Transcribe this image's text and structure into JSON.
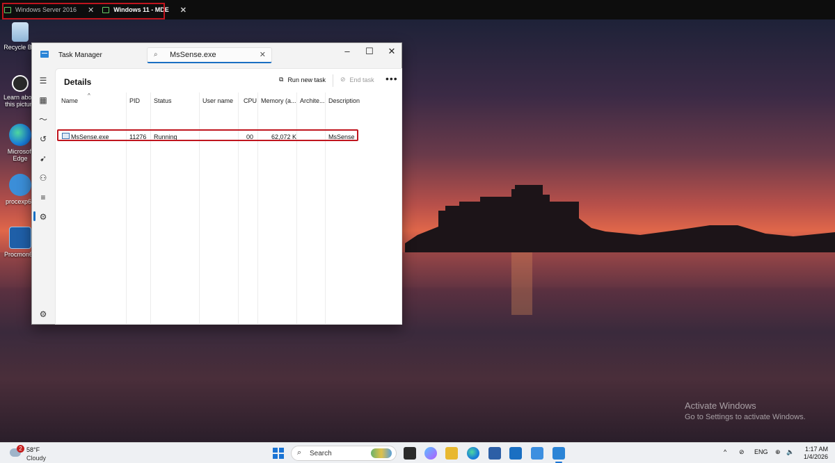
{
  "remote_tabs": [
    {
      "label": "Windows Server 2016",
      "close": "✕"
    },
    {
      "label": "Windows 11 - MDE",
      "close": "✕"
    }
  ],
  "desktop_icons": [
    {
      "label": "Recycle Bin"
    },
    {
      "label": "Learn about this picture"
    },
    {
      "label": "Microsoft Edge"
    },
    {
      "label": "procexp64"
    },
    {
      "label": "Procmon64"
    }
  ],
  "task_manager": {
    "title": "Task Manager",
    "search_value": "MsSense.exe",
    "section": "Details",
    "run_new_task": "Run new task",
    "end_task": "End task",
    "more": "•••",
    "columns": [
      "Name",
      "PID",
      "Status",
      "User name",
      "CPU",
      "Memory (a...",
      "Archite...",
      "Description"
    ],
    "rows": [
      {
        "name": "MsSense.exe",
        "pid": "11276",
        "status": "Running",
        "user": "",
        "cpu": "00",
        "memory": "62,072 K",
        "arch": "",
        "description": "MsSense"
      }
    ]
  },
  "watermark": {
    "line1": "Activate Windows",
    "line2": "Go to Settings to activate Windows."
  },
  "taskbar": {
    "weather_badge": "2",
    "temperature": "58°F",
    "condition": "Cloudy",
    "search_label": "Search",
    "language": "ENG",
    "time": "1:17 AM",
    "date": "1/4/2026"
  },
  "colors": {
    "highlight": "#c0151e",
    "accent": "#1a6fc2"
  }
}
